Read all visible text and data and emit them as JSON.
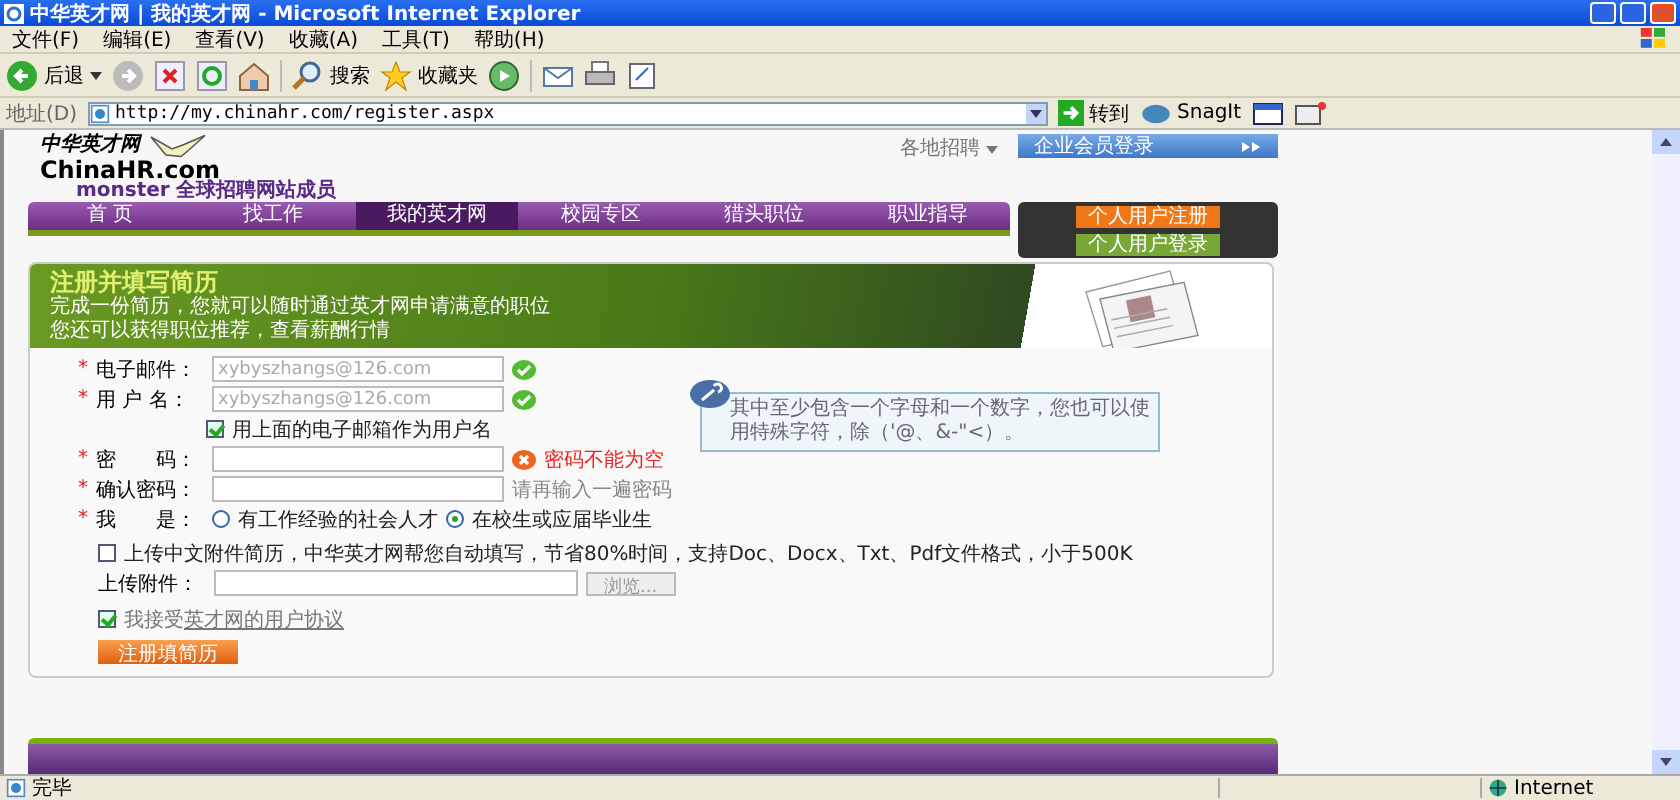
{
  "window": {
    "title": "中华英才网 | 我的英才网 - Microsoft Internet Explorer"
  },
  "menu": [
    "文件(F)",
    "编辑(E)",
    "查看(V)",
    "收藏(A)",
    "工具(T)",
    "帮助(H)"
  ],
  "toolbar": {
    "back": "后退",
    "search": "搜索",
    "favorites": "收藏夹"
  },
  "address": {
    "label": "地址(D)",
    "url": "http://my.chinahr.com/register.aspx",
    "go": "转到",
    "snagit": "SnagIt"
  },
  "site": {
    "logo_cn": "中华英才网",
    "logo_en": "ChinaHR.com",
    "tagline_brand": "monster",
    "tagline": "全球招聘网站成员",
    "region": "各地招聘",
    "enterprise_login": "企业会员登录",
    "nav": [
      {
        "label": "首 页",
        "selected": false
      },
      {
        "label": "找工作",
        "selected": false
      },
      {
        "label": "我的英才网",
        "selected": true
      },
      {
        "label": "校园专区",
        "selected": false
      },
      {
        "label": "猎头职位",
        "selected": false
      },
      {
        "label": "职业指导",
        "selected": false
      }
    ],
    "register": "个人用户注册",
    "login": "个人用户登录"
  },
  "banner": {
    "title": "注册并填写简历",
    "lines": [
      "完成一份简历，您就可以随时通过英才网申请满意的职位",
      "您还可以获得职位推荐，查看薪酬行情"
    ]
  },
  "form": {
    "fields": [
      {
        "kind": "input",
        "mark": "*",
        "label": "电子邮件：",
        "value": "xybyszhangs@126.com",
        "valid": true
      },
      {
        "kind": "input",
        "mark": "*",
        "label": "用 户 名：",
        "value": "xybyszhangs@126.com",
        "valid": true
      },
      {
        "kind": "checkbox",
        "label": "用上面的电子邮箱作为用户名",
        "checked": true
      },
      {
        "kind": "input",
        "mark": "*",
        "label": "密　　码：",
        "valid": false,
        "message": "密码不能为空"
      },
      {
        "kind": "input",
        "mark": "*",
        "label": "确认密码：",
        "hint": "请再输入一遍密码"
      },
      {
        "kind": "radio",
        "mark": "*",
        "label": "我　　是：",
        "options": [
          {
            "label": "有工作经验的社会人才",
            "selected": false
          },
          {
            "label": "在校生或应届毕业生",
            "selected": true
          }
        ]
      }
    ],
    "tip": "其中至少包含一个字母和一个数字，您也可以使用特殊字符，除（'@、&-\"<）。",
    "upload": {
      "checked": false,
      "text": "上传中文附件简历，中华英才网帮您自动填写，节省80%时间，支持Doc、Docx、Txt、Pdf文件格式，小于500K",
      "label": "上传附件：",
      "browse": "浏览..."
    },
    "agree": {
      "checked": true,
      "prefix": "我接受",
      "link": "英才网的用户协议"
    },
    "submit": "注册填简历"
  },
  "status_bar": {
    "text": "完毕",
    "zone": "Internet"
  }
}
